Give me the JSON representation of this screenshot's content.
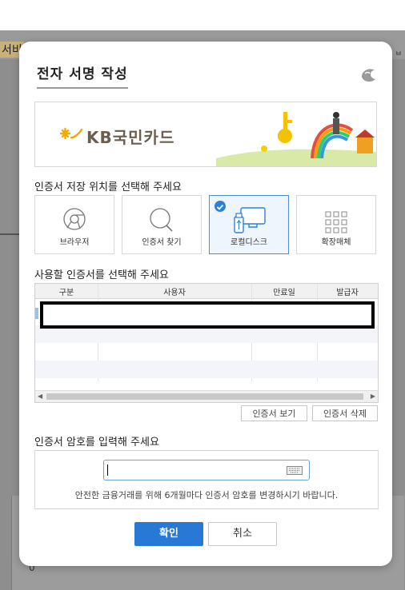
{
  "background": {
    "left_label": "서비",
    "right_label": "ㅂ",
    "zero": "0"
  },
  "dialog": {
    "title": "전자 서명 작성",
    "banner": {
      "brand": "KB국민카드"
    },
    "location_prompt": "인증서 저장 위치를 선택해 주세요",
    "locations": [
      {
        "label": "브라우저",
        "icon": "browser-icon",
        "selected": false
      },
      {
        "label": "인증서 찾기",
        "icon": "search-icon",
        "selected": false
      },
      {
        "label": "로컬디스크",
        "icon": "local-disk-icon",
        "selected": true
      },
      {
        "label": "확장매체",
        "icon": "extended-media-icon",
        "selected": false
      }
    ],
    "cert_prompt": "사용할 인증서를 선택해 주세요",
    "table": {
      "columns": [
        "구분",
        "사용자",
        "만료일",
        "발급자"
      ]
    },
    "view_cert_label": "인증서 보기",
    "delete_cert_label": "인증서 삭제",
    "password_prompt": "인증서 암호를 입력해 주세요",
    "password_value": "",
    "password_note": "안전한 금융거래를 위해 6개월마다 인증서 암호를 변경하시기 바랍니다.",
    "confirm_label": "확인",
    "cancel_label": "취소",
    "colors": {
      "accent": "#2878d6",
      "selection_border": "#4a90d9"
    }
  }
}
